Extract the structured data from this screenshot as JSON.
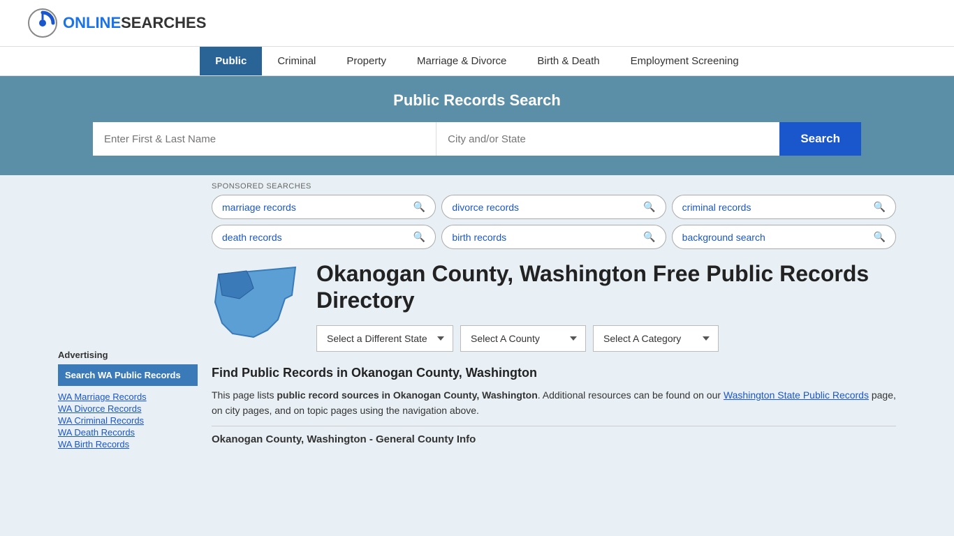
{
  "header": {
    "logo_text_online": "ONLINE",
    "logo_text_searches": "SEARCHES"
  },
  "nav": {
    "items": [
      {
        "label": "Public",
        "active": true
      },
      {
        "label": "Criminal",
        "active": false
      },
      {
        "label": "Property",
        "active": false
      },
      {
        "label": "Marriage & Divorce",
        "active": false
      },
      {
        "label": "Birth & Death",
        "active": false
      },
      {
        "label": "Employment Screening",
        "active": false
      }
    ]
  },
  "search_banner": {
    "title": "Public Records Search",
    "name_placeholder": "Enter First & Last Name",
    "location_placeholder": "City and/or State",
    "button_label": "Search"
  },
  "sponsored": {
    "label": "SPONSORED SEARCHES",
    "tags": [
      {
        "text": "marriage records"
      },
      {
        "text": "divorce records"
      },
      {
        "text": "criminal records"
      },
      {
        "text": "death records"
      },
      {
        "text": "birth records"
      },
      {
        "text": "background search"
      }
    ]
  },
  "county": {
    "title": "Okanogan County, Washington Free Public Records Directory",
    "dropdowns": {
      "state": "Select a Different State",
      "county": "Select A County",
      "category": "Select A Category"
    }
  },
  "find_section": {
    "title": "Find Public Records in Okanogan County, Washington",
    "text_part1": "This page lists ",
    "text_bold": "public record sources in Okanogan County, Washington",
    "text_part2": ". Additional resources can be found on our ",
    "link_text": "Washington State Public Records",
    "text_part3": " page, on city pages, and on topic pages using the navigation above."
  },
  "general_info": {
    "header": "Okanogan County, Washington - General County Info"
  },
  "sidebar": {
    "advertising_label": "Advertising",
    "ad_box_text": "Search WA Public Records",
    "links": [
      "WA Marriage Records",
      "WA Divorce Records",
      "WA Criminal Records",
      "WA Death Records",
      "WA Birth Records"
    ]
  }
}
